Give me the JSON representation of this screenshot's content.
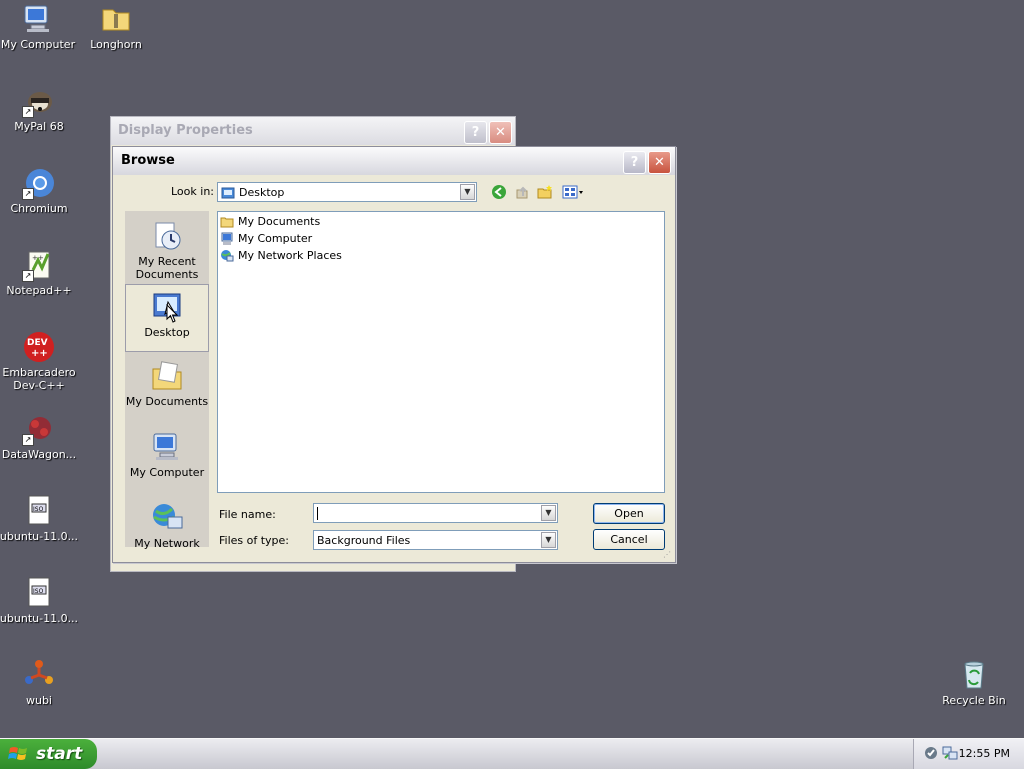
{
  "desktop": {
    "icons": [
      {
        "label": "My Computer",
        "icon": "my-computer-icon"
      },
      {
        "label": "Longhorn",
        "icon": "folder-icon"
      },
      {
        "label": "MyPal 68",
        "icon": "mypal-icon"
      },
      {
        "label": "Chromium",
        "icon": "chromium-icon"
      },
      {
        "label": "Notepad++",
        "icon": "notepadpp-icon"
      },
      {
        "label": "Embarcadero\nDev-C++",
        "icon": "devcpp-icon"
      },
      {
        "label": "DataWagon...",
        "icon": "datawagon-icon"
      },
      {
        "label": "ubuntu-11.0...",
        "icon": "iso-file-icon"
      },
      {
        "label": "ubuntu-11.0...",
        "icon": "iso-file-icon"
      },
      {
        "label": "wubi",
        "icon": "wubi-icon"
      },
      {
        "label": "Recycle Bin",
        "icon": "recycle-bin-icon"
      }
    ]
  },
  "display_properties": {
    "title": "Display Properties",
    "help_glyph": "?",
    "close_glyph": "✕"
  },
  "browse": {
    "title": "Browse",
    "help_glyph": "?",
    "close_glyph": "✕",
    "look_in_label": "Look in:",
    "look_in_value": "Desktop",
    "places": [
      {
        "label": "My Recent\nDocuments",
        "selected": false
      },
      {
        "label": "Desktop",
        "selected": true
      },
      {
        "label": "My Documents",
        "selected": false
      },
      {
        "label": "My Computer",
        "selected": false
      },
      {
        "label": "My Network",
        "selected": false
      }
    ],
    "files": [
      "My Documents",
      "My Computer",
      "My Network Places"
    ],
    "file_name_label": "File name:",
    "file_name_value": "",
    "files_of_type_label": "Files of type:",
    "files_of_type_value": "Background Files",
    "open_label": "Open",
    "cancel_label": "Cancel"
  },
  "taskbar": {
    "start_label": "start",
    "clock": "12:55 PM"
  },
  "colors": {
    "desktop": "#5a5a66",
    "dialog": "#ece9d8",
    "start_green": "#3a9e34",
    "close_red": "#c8533e"
  }
}
